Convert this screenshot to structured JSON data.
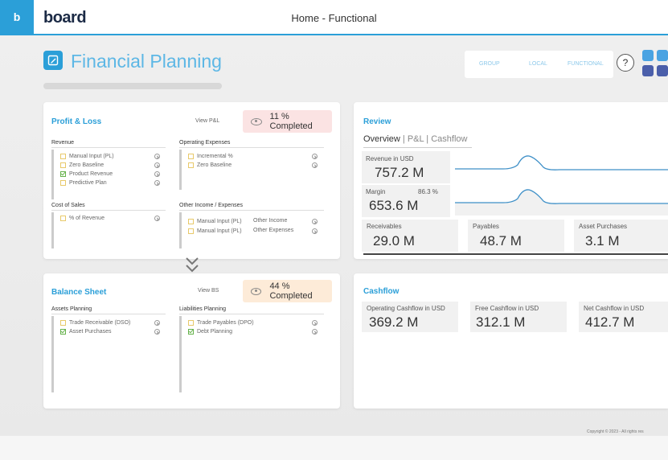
{
  "app": {
    "logo_letter": "b",
    "brand": "board",
    "title": "Home - Functional"
  },
  "header": {
    "title": "Financial Planning",
    "view_options": [
      "GROUP",
      "LOCAL",
      "FUNCTIONAL"
    ],
    "help_label": "?"
  },
  "profit_loss": {
    "title": "Profit & Loss",
    "view_link": "View P&L",
    "completion": "11 % Completed",
    "revenue": {
      "heading": "Revenue",
      "items": [
        {
          "label": "Manual Input (PL)",
          "checked": false
        },
        {
          "label": "Zero Baseline",
          "checked": false
        },
        {
          "label": "Product Revenue",
          "checked": true
        },
        {
          "label": "Predictive Plan",
          "checked": false
        }
      ]
    },
    "cost_of_sales": {
      "heading": "Cost of Sales",
      "items": [
        {
          "label": "% of Revenue",
          "checked": false
        }
      ]
    },
    "operating_expenses": {
      "heading": "Operating Expenses",
      "items": [
        {
          "label": "Incremental %",
          "checked": false
        },
        {
          "label": "Zero Baseline",
          "checked": false
        }
      ]
    },
    "other_income": {
      "heading": "Other Income / Expenses",
      "items": [
        {
          "label": "Manual Input (PL)",
          "extra": "Other Income",
          "checked": false
        },
        {
          "label": "Manual Input (PL)",
          "extra": "Other Expenses",
          "checked": false
        }
      ]
    }
  },
  "balance_sheet": {
    "title": "Balance Sheet",
    "view_link": "View BS",
    "completion": "44 % Completed",
    "assets": {
      "heading": "Assets Planning",
      "items": [
        {
          "label": "Trade Receivable (DSO)",
          "checked": false
        },
        {
          "label": "Asset Purchases",
          "checked": true
        }
      ]
    },
    "liabilities": {
      "heading": "Liabilities Planning",
      "items": [
        {
          "label": "Trade Payables (DPO)",
          "checked": false
        },
        {
          "label": "Debt Planning",
          "checked": true
        }
      ]
    }
  },
  "review": {
    "title": "Review",
    "tabs": [
      "Overview",
      "P&L",
      "Cashflow"
    ],
    "active_tab": "Overview",
    "revenue": {
      "label": "Revenue in USD",
      "value": "757.2 M"
    },
    "margin": {
      "label": "Margin",
      "pct": "86.3 %",
      "value": "653.6 M"
    },
    "receivables": {
      "label": "Receivables",
      "value": "29.0 M"
    },
    "payables": {
      "label": "Payables",
      "value": "48.7 M"
    },
    "asset_purchases": {
      "label": "Asset Purchases",
      "value": "3.1 M"
    }
  },
  "cashflow": {
    "title": "Cashflow",
    "operating": {
      "label": "Operating Cashflow in USD",
      "value": "369.2 M"
    },
    "free": {
      "label": "Free Cashflow in USD",
      "value": "312.1 M"
    },
    "net": {
      "label": "Net Cashflow in USD",
      "value": "412.7 M"
    }
  },
  "footer": {
    "copyright": "Copyright © 2023 - All rights res"
  },
  "colors": {
    "accent": "#2b9fd8",
    "title_blue": "#5db7e5",
    "pl_badge": "#fbe3e3",
    "bs_badge": "#fdebd8",
    "check_on": "#66b24c",
    "check_off": "#e8c96a",
    "tile_light": "#4aa3e2",
    "tile_dark": "#4b5faa"
  }
}
